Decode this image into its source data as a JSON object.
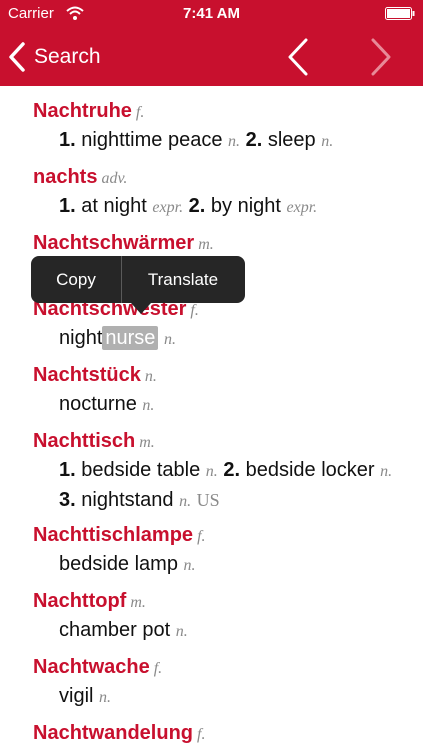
{
  "status": {
    "carrier": "Carrier",
    "time": "7:41 AM"
  },
  "nav": {
    "back_label": "Search"
  },
  "entries": [
    {
      "word": "Nachtruhe",
      "gender": "f.",
      "senses": [
        {
          "num": "1.",
          "text": "nighttime peace",
          "pos": "n."
        },
        {
          "num": "2.",
          "text": "sleep",
          "pos": "n."
        }
      ]
    },
    {
      "word": "nachts",
      "gender": "adv.",
      "senses": [
        {
          "num": "1.",
          "text": "at night",
          "pos": "expr."
        },
        {
          "num": "2.",
          "text": "by night",
          "pos": "expr."
        }
      ]
    },
    {
      "word": "Nachtschwärmer",
      "gender": "m."
    },
    {
      "word": "Nachtschwester",
      "gender": "f.",
      "def_pre": "night",
      "def_sel": "nurse",
      "pos": "n."
    },
    {
      "word": "Nachtstück",
      "gender": "n.",
      "def": "nocturne",
      "pos": "n."
    },
    {
      "word": "Nachttisch",
      "gender": "m.",
      "senses": [
        {
          "num": "1.",
          "text": "bedside table",
          "pos": "n."
        },
        {
          "num": "2.",
          "text": "bedside locker",
          "pos": "n."
        },
        {
          "num": "3.",
          "text": "nightstand",
          "pos": "n.",
          "region": "US"
        }
      ]
    },
    {
      "word": "Nachttischlampe",
      "gender": "f.",
      "def": "bedside lamp",
      "pos": "n."
    },
    {
      "word": "Nachttopf",
      "gender": "m.",
      "def": "chamber pot",
      "pos": "n."
    },
    {
      "word": "Nachtwache",
      "gender": "f.",
      "def": "vigil",
      "pos": "n."
    },
    {
      "word": "Nachtwandelung",
      "gender": "f."
    }
  ],
  "popup": {
    "copy": "Copy",
    "translate": "Translate"
  }
}
